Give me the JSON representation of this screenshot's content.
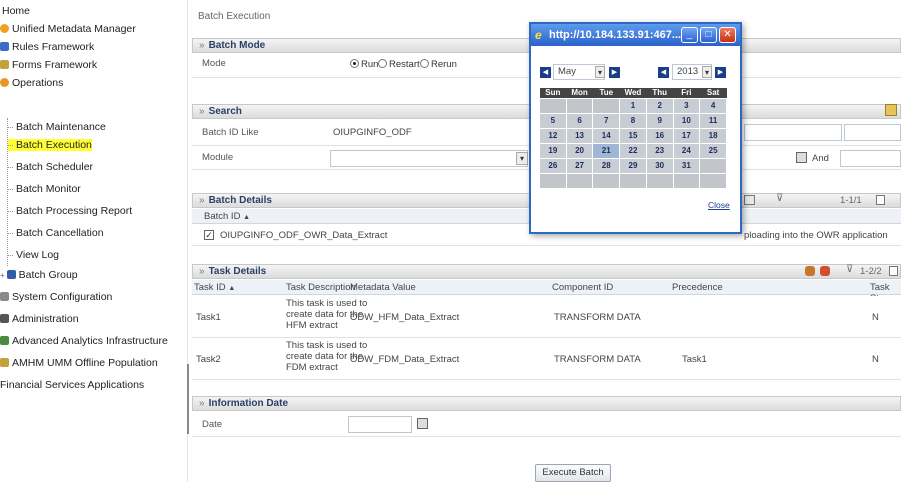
{
  "sidebar": {
    "items": [
      {
        "label": "Home"
      },
      {
        "label": "Unified Metadata Manager"
      },
      {
        "label": "Rules Framework"
      },
      {
        "label": "Forms Framework"
      },
      {
        "label": "Operations"
      },
      {
        "label": "Batch Maintenance"
      },
      {
        "label": "Batch Execution"
      },
      {
        "label": "Batch Scheduler"
      },
      {
        "label": "Batch Monitor"
      },
      {
        "label": "Batch Processing Report"
      },
      {
        "label": "Batch Cancellation"
      },
      {
        "label": "View Log"
      },
      {
        "label": "Batch Group"
      },
      {
        "label": "System Configuration"
      },
      {
        "label": "Administration"
      },
      {
        "label": "Advanced Analytics Infrastructure"
      },
      {
        "label": "AMHM UMM Offline Population"
      },
      {
        "label": "Financial Services Applications"
      }
    ],
    "expand_marker": "+"
  },
  "main": {
    "page_title": "Batch Execution",
    "batch_mode": {
      "header": "Batch Mode",
      "mode_label": "Mode",
      "options": [
        "Run",
        "Restart",
        "Rerun"
      ],
      "selected": "Run"
    },
    "search": {
      "header": "Search",
      "batch_id_label": "Batch ID Like",
      "batch_id_value": "OIUPGINFO_ODF",
      "module_label": "Module",
      "and_label": "And"
    },
    "batch_details": {
      "header": "Batch Details",
      "pager": "1-1/1",
      "column": "Batch ID",
      "row_value": "OIUPGINFO_ODF_OWR_Data_Extract",
      "row_description": "ploading into the OWR application"
    },
    "task_details": {
      "header": "Task Details",
      "pager": "1-2/2",
      "columns": [
        "Task ID",
        "Task Description",
        "Metadata Value",
        "Component ID",
        "Precedence",
        "Task Sta"
      ],
      "rows": [
        {
          "task_id": "Task1",
          "desc1": "This task is used to",
          "desc2": "create data for the",
          "desc3": "HFM extract",
          "metadata": "ODW_HFM_Data_Extract",
          "component": "TRANSFORM DATA",
          "precedence": "",
          "status": "N"
        },
        {
          "task_id": "Task2",
          "desc1": "This task is used to",
          "desc2": "create data for the",
          "desc3": "FDM extract",
          "metadata": "ODW_FDM_Data_Extract",
          "component": "TRANSFORM DATA",
          "precedence": "Task1",
          "status": "N"
        }
      ]
    },
    "information_date": {
      "header": "Information Date",
      "date_label": "Date"
    },
    "execute_button": "Execute Batch"
  },
  "popup": {
    "title": "http://10.184.133.91:467...",
    "month": "May",
    "year": "2013",
    "weekdays": [
      "Sun",
      "Mon",
      "Tue",
      "Wed",
      "Thu",
      "Fri",
      "Sat"
    ],
    "weeks": [
      [
        "",
        "",
        "",
        "1",
        "2",
        "3",
        "4"
      ],
      [
        "5",
        "6",
        "7",
        "8",
        "9",
        "10",
        "11"
      ],
      [
        "12",
        "13",
        "14",
        "15",
        "16",
        "17",
        "18"
      ],
      [
        "19",
        "20",
        "21",
        "22",
        "23",
        "24",
        "25"
      ],
      [
        "26",
        "27",
        "28",
        "29",
        "30",
        "31",
        ""
      ],
      [
        "",
        "",
        "",
        "",
        "",
        "",
        ""
      ]
    ],
    "today": "21",
    "close_label": "Close"
  },
  "colors": {
    "active_highlight": "#ffff33",
    "header_text": "#2b3f66",
    "popup_titlebar": "#2a62c9"
  }
}
